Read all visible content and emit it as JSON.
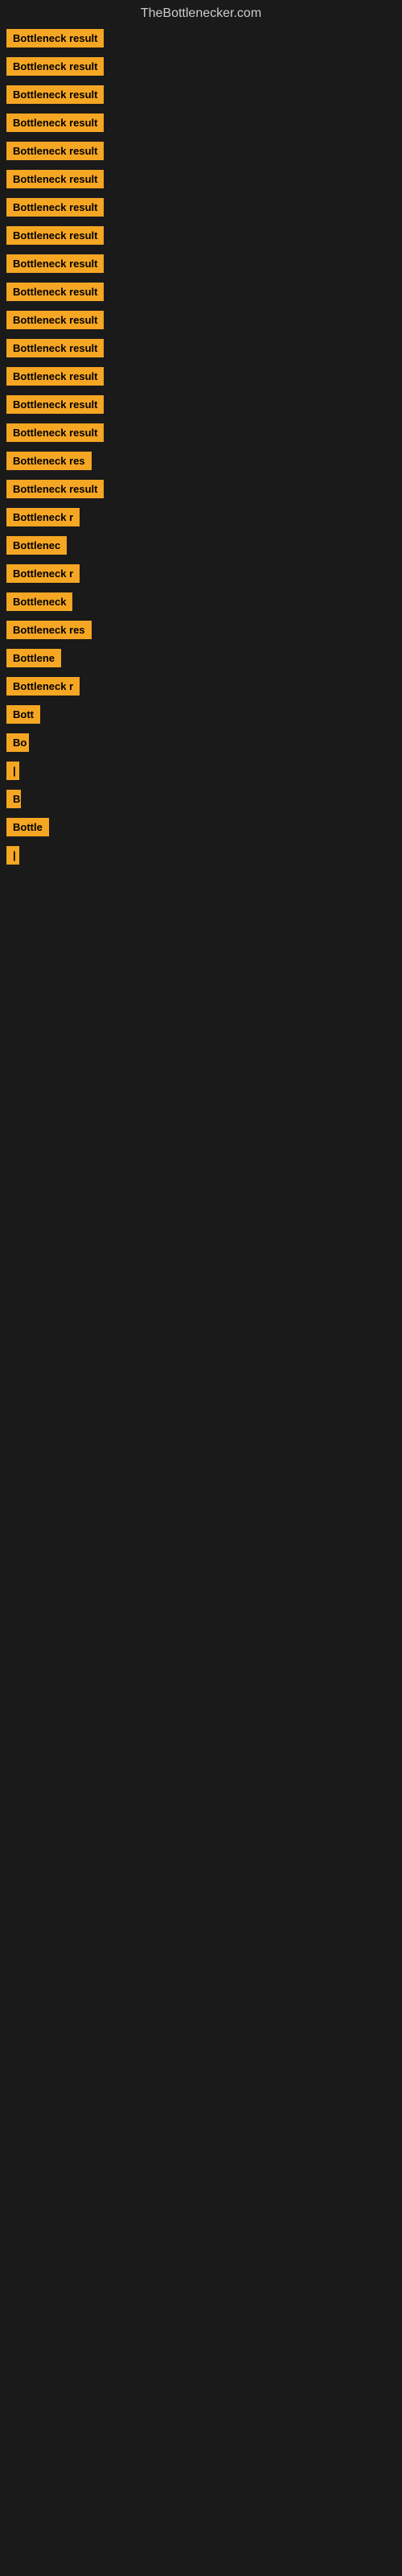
{
  "site": {
    "title": "TheBottlenecker.com"
  },
  "rows": [
    {
      "label": "Bottleneck result",
      "badgeWidth": 140
    },
    {
      "label": "Bottleneck result",
      "badgeWidth": 140
    },
    {
      "label": "Bottleneck result",
      "badgeWidth": 140
    },
    {
      "label": "Bottleneck result",
      "badgeWidth": 140
    },
    {
      "label": "Bottleneck result",
      "badgeWidth": 140
    },
    {
      "label": "Bottleneck result",
      "badgeWidth": 140
    },
    {
      "label": "Bottleneck result",
      "badgeWidth": 140
    },
    {
      "label": "Bottleneck result",
      "badgeWidth": 140
    },
    {
      "label": "Bottleneck result",
      "badgeWidth": 140
    },
    {
      "label": "Bottleneck result",
      "badgeWidth": 140
    },
    {
      "label": "Bottleneck result",
      "badgeWidth": 140
    },
    {
      "label": "Bottleneck result",
      "badgeWidth": 140
    },
    {
      "label": "Bottleneck result",
      "badgeWidth": 140
    },
    {
      "label": "Bottleneck result",
      "badgeWidth": 140
    },
    {
      "label": "Bottleneck result",
      "badgeWidth": 140
    },
    {
      "label": "Bottleneck res",
      "badgeWidth": 118
    },
    {
      "label": "Bottleneck result",
      "badgeWidth": 140
    },
    {
      "label": "Bottleneck r",
      "badgeWidth": 100
    },
    {
      "label": "Bottlenec",
      "badgeWidth": 82
    },
    {
      "label": "Bottleneck r",
      "badgeWidth": 100
    },
    {
      "label": "Bottleneck",
      "badgeWidth": 86
    },
    {
      "label": "Bottleneck res",
      "badgeWidth": 118
    },
    {
      "label": "Bottlene",
      "badgeWidth": 72
    },
    {
      "label": "Bottleneck r",
      "badgeWidth": 100
    },
    {
      "label": "Bott",
      "badgeWidth": 46
    },
    {
      "label": "Bo",
      "badgeWidth": 28
    },
    {
      "label": "|",
      "badgeWidth": 10
    },
    {
      "label": "B",
      "badgeWidth": 18
    },
    {
      "label": "Bottle",
      "badgeWidth": 54
    },
    {
      "label": "|",
      "badgeWidth": 10
    }
  ]
}
